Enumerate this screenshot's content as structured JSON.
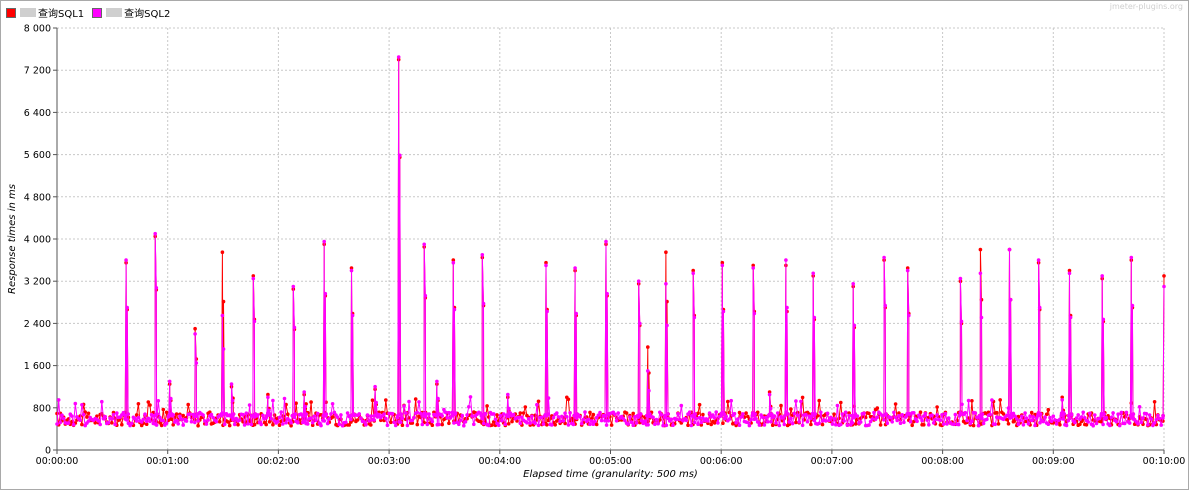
{
  "watermark": "jmeter-plugins.org",
  "chart_data": {
    "type": "line",
    "title": "",
    "xlabel": "Elapsed time (granularity: 500 ms)",
    "ylabel": "Response times in ms",
    "xlim": [
      0,
      600
    ],
    "ylim": [
      0,
      8000
    ],
    "grid": true,
    "legend_position": "top-left",
    "x_ticks": [
      "00:00:00",
      "00:01:00",
      "00:02:00",
      "00:03:00",
      "00:04:00",
      "00:05:00",
      "00:06:00",
      "00:07:00",
      "00:08:00",
      "00:09:00",
      "00:10:00"
    ],
    "y_ticks": [
      "0",
      "800",
      "1 600",
      "2 400",
      "3 200",
      "4 000",
      "4 800",
      "5 600",
      "6 400",
      "7 200",
      "8 000"
    ],
    "baseline_ms": 600,
    "series": [
      {
        "name": "查询SQL1",
        "color": "#ff0000",
        "spikes": [
          [
            38,
            3550
          ],
          [
            54,
            4050
          ],
          [
            62,
            1250
          ],
          [
            76,
            2300
          ],
          [
            91,
            3750
          ],
          [
            96,
            1200
          ],
          [
            108,
            3300
          ],
          [
            116,
            1050
          ],
          [
            130,
            3050
          ],
          [
            136,
            1050
          ],
          [
            147,
            3900
          ],
          [
            162,
            3450
          ],
          [
            175,
            1150
          ],
          [
            188,
            7400
          ],
          [
            202,
            3850
          ],
          [
            209,
            1250
          ],
          [
            218,
            3600
          ],
          [
            234,
            3650
          ],
          [
            248,
            1000
          ],
          [
            269,
            3550
          ],
          [
            285,
            3400
          ],
          [
            302,
            3900
          ],
          [
            320,
            3150
          ],
          [
            325,
            1950
          ],
          [
            335,
            3750
          ],
          [
            350,
            3400
          ],
          [
            366,
            3550
          ],
          [
            383,
            3500
          ],
          [
            392,
            1100
          ],
          [
            401,
            3500
          ],
          [
            416,
            3300
          ],
          [
            438,
            3100
          ],
          [
            455,
            3600
          ],
          [
            468,
            3450
          ],
          [
            497,
            3200
          ],
          [
            508,
            3800
          ],
          [
            524,
            3800
          ],
          [
            540,
            3550
          ],
          [
            553,
            1000
          ],
          [
            557,
            3400
          ],
          [
            575,
            3250
          ],
          [
            591,
            3600
          ],
          [
            609,
            3300
          ]
        ]
      },
      {
        "name": "查询SQL2",
        "color": "#ff00ff",
        "spikes": [
          [
            38,
            3600
          ],
          [
            54,
            4100
          ],
          [
            62,
            1300
          ],
          [
            76,
            2200
          ],
          [
            91,
            2550
          ],
          [
            96,
            1250
          ],
          [
            108,
            3250
          ],
          [
            116,
            1000
          ],
          [
            130,
            3100
          ],
          [
            136,
            1100
          ],
          [
            147,
            3950
          ],
          [
            162,
            3400
          ],
          [
            175,
            1200
          ],
          [
            188,
            7450
          ],
          [
            202,
            3900
          ],
          [
            209,
            1300
          ],
          [
            218,
            3550
          ],
          [
            234,
            3700
          ],
          [
            248,
            1050
          ],
          [
            269,
            3500
          ],
          [
            285,
            3450
          ],
          [
            302,
            3950
          ],
          [
            320,
            3200
          ],
          [
            325,
            1500
          ],
          [
            335,
            3150
          ],
          [
            350,
            3350
          ],
          [
            366,
            3500
          ],
          [
            383,
            3450
          ],
          [
            392,
            1050
          ],
          [
            401,
            3600
          ],
          [
            416,
            3350
          ],
          [
            438,
            3150
          ],
          [
            455,
            3650
          ],
          [
            468,
            3400
          ],
          [
            497,
            3250
          ],
          [
            508,
            3350
          ],
          [
            524,
            3800
          ],
          [
            540,
            3600
          ],
          [
            553,
            950
          ],
          [
            557,
            3350
          ],
          [
            575,
            3300
          ],
          [
            591,
            3650
          ],
          [
            609,
            3100
          ]
        ]
      }
    ]
  }
}
